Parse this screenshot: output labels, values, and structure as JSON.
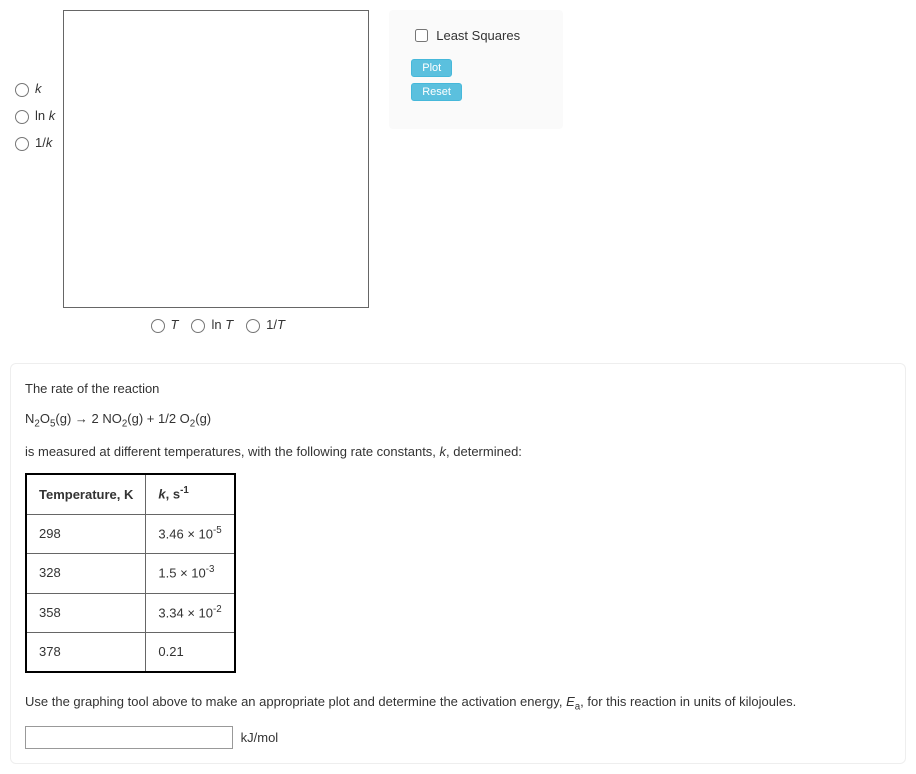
{
  "yAxis": {
    "options": [
      {
        "html": "<span class='italic'>k</span>"
      },
      {
        "html": "ln <span class='italic'>k</span>"
      },
      {
        "html": "1/<span class='italic'>k</span>"
      }
    ]
  },
  "xAxis": {
    "options": [
      {
        "html": "<span class='italic'>T</span>"
      },
      {
        "html": "ln <span class='italic'>T</span>"
      },
      {
        "html": "1/<span class='italic'>T</span>"
      }
    ]
  },
  "controls": {
    "leastSquares": "Least Squares",
    "plot": "Plot",
    "reset": "Reset"
  },
  "question": {
    "intro": "The rate of the reaction",
    "equation_html": "N<sub>2</sub>O<sub>5</sub>(g) → 2 NO<sub>2</sub>(g) + 1/2 O<sub>2</sub>(g)",
    "measured_html": "is measured at different temperatures, with the following rate constants, <span class='italic'>k</span>, determined:",
    "table": {
      "headers": [
        {
          "html": "Temperature, K"
        },
        {
          "html": "<span class='italic'>k</span>, s<sup>-1</sup>"
        }
      ],
      "rows": [
        {
          "temp": "298",
          "k_html": "3.46 × 10<sup>-5</sup>"
        },
        {
          "temp": "328",
          "k_html": "1.5 × 10<sup>-3</sup>"
        },
        {
          "temp": "358",
          "k_html": "3.34 × 10<sup>-2</sup>"
        },
        {
          "temp": "378",
          "k_html": "0.21"
        }
      ]
    },
    "prompt_html": "Use the graphing tool above to make an appropriate plot and determine the activation energy, <span class='italic'>E</span><sub>a</sub>, for this reaction in units of kilojoules.",
    "unit": "kJ/mol"
  }
}
